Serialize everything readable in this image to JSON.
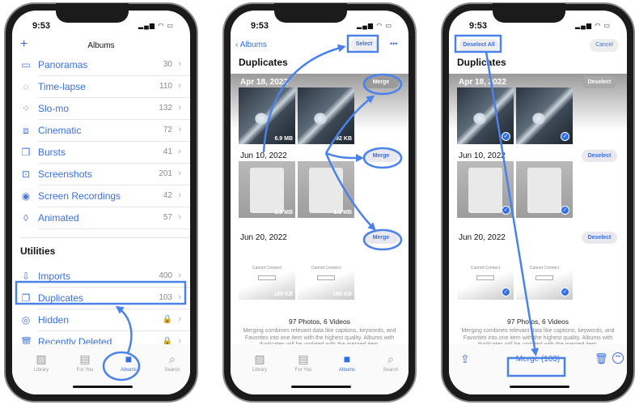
{
  "status_time": "9:53",
  "accent": "#3b6fd8",
  "annotation_color": "#4a82ea",
  "albums_screen": {
    "add_icon": "plus-icon",
    "title": "Albums",
    "media_types": [
      {
        "label": "Panoramas",
        "count": "30",
        "icon": "panorama-icon"
      },
      {
        "label": "Time-lapse",
        "count": "110",
        "icon": "timelapse-icon"
      },
      {
        "label": "Slo-mo",
        "count": "132",
        "icon": "slomo-icon"
      },
      {
        "label": "Cinematic",
        "count": "72",
        "icon": "cinematic-icon"
      },
      {
        "label": "Bursts",
        "count": "41",
        "icon": "bursts-icon"
      },
      {
        "label": "Screenshots",
        "count": "201",
        "icon": "screenshot-icon"
      },
      {
        "label": "Screen Recordings",
        "count": "42",
        "icon": "record-icon"
      },
      {
        "label": "Animated",
        "count": "57",
        "icon": "animated-icon"
      }
    ],
    "utilities_header": "Utilities",
    "utilities": [
      {
        "label": "Imports",
        "count": "400",
        "icon": "import-icon"
      },
      {
        "label": "Duplicates",
        "count": "103",
        "icon": "duplicates-icon"
      },
      {
        "label": "Hidden",
        "count": "",
        "icon": "hidden-icon",
        "locked": true
      },
      {
        "label": "Recently Deleted",
        "count": "",
        "icon": "trash-icon",
        "locked": true
      }
    ]
  },
  "tabs": [
    {
      "label": "Library",
      "icon": "library-icon"
    },
    {
      "label": "For You",
      "icon": "for-you-icon"
    },
    {
      "label": "Albums",
      "icon": "albums-icon",
      "active": true
    },
    {
      "label": "Search",
      "icon": "search-icon"
    }
  ],
  "duplicates_screen": {
    "back_label": "Albums",
    "select_label": "Select",
    "title": "Duplicates",
    "merge_label": "Merge",
    "groups": [
      {
        "date": "Apr 18, 2022",
        "sizes": [
          "6.9 MB",
          "92 KB"
        ]
      },
      {
        "date": "Jun 10, 2022",
        "sizes": [
          "1.3 MB",
          "1.3 MB"
        ]
      },
      {
        "date": "Jun 20, 2022",
        "sizes": [
          "180 KB",
          "180 KB"
        ],
        "caption": "Cannot Connect"
      }
    ],
    "summary": "97 Photos, 6 Videos",
    "description": "Merging combines relevant data like captions, keywords, and Favorites into one item with the highest quality. Albums with duplicates will be updated with the merged item."
  },
  "select_screen": {
    "deselect_all_label": "Deselect All",
    "cancel_label": "Cancel",
    "deselect_label": "Deselect",
    "merge_count_label": "Merge (103)"
  }
}
